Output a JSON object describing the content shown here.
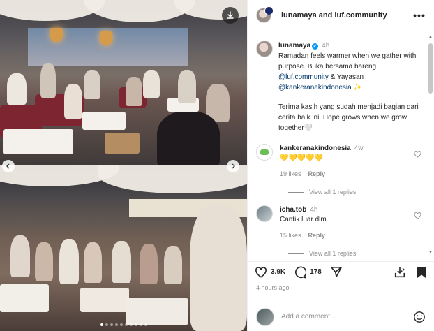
{
  "header": {
    "title": "lunamaya and luf.community",
    "more_icon": "more-horizontal-icon"
  },
  "caption": {
    "username": "lunamaya",
    "verified": "✔",
    "time": "4h",
    "line1": "Ramadan feels warmer when we gather with purpose. Buka bersama bareng ",
    "mention1": "@luf.community",
    "amp": " & Yayasan ",
    "mention2": "@kankeranakindonesia",
    "sparkle": " ✨",
    "para2": "Terima kasih yang sudah menjadi bagian dari cerita baik ini. Hope grows when we grow together🤍"
  },
  "comments": [
    {
      "username": "kankeranakindonesia",
      "time": "4w",
      "text": "💛💛💛💛💛",
      "likes": "19 likes",
      "reply": "Reply",
      "view_replies": "View all 1 replies"
    },
    {
      "username": "icha.tob",
      "time": "4h",
      "text": "Cantik luar dlm",
      "likes": "15 likes",
      "reply": "Reply",
      "view_replies": "View all 1 replies"
    }
  ],
  "actions": {
    "like_count": "3.9K",
    "comment_count": "178",
    "posted_time": "4 hours ago"
  },
  "comment_box": {
    "placeholder": "Add a comment..."
  },
  "carousel": {
    "total_slides": 10,
    "active_slide": 0
  },
  "colors": {
    "link": "#00376b",
    "muted": "#8e8e8e",
    "verified": "#0095f6"
  }
}
